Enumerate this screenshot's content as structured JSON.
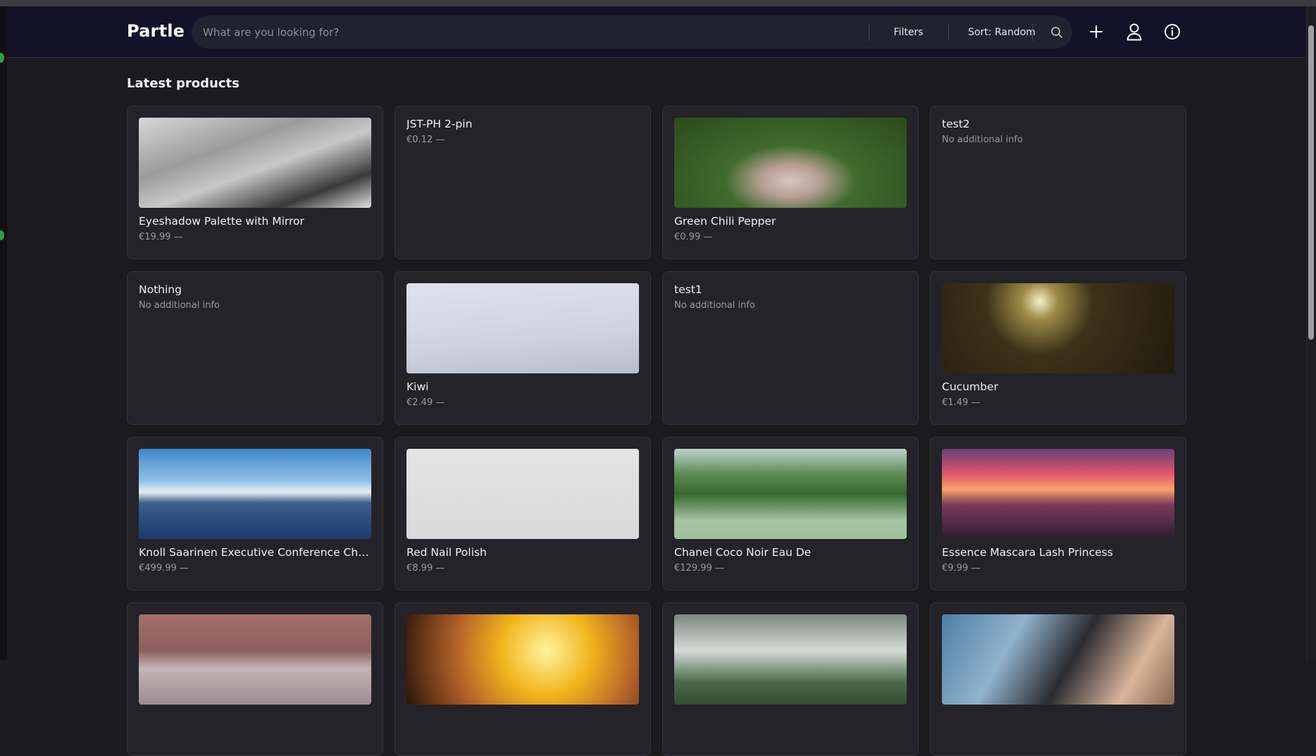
{
  "app": {
    "brand": "Partle"
  },
  "search": {
    "placeholder": "What are you looking for?",
    "value": "",
    "filters_label": "Filters",
    "sort_label": "Sort: Random"
  },
  "icons": {
    "search": "search-icon",
    "add": "plus-icon",
    "account": "user-icon",
    "info": "info-icon"
  },
  "section": {
    "title": "Latest products"
  },
  "products": [
    {
      "name": "Eyeshadow Palette with Mirror",
      "sub": "€19.99 —",
      "has_image": true,
      "image": "bw-laptop-keyboard"
    },
    {
      "name": "JST-PH 2-pin",
      "sub": "€0.12 —",
      "has_image": false
    },
    {
      "name": "Green Chili Pepper",
      "sub": "€0.99 —",
      "has_image": true,
      "image": "blanket-in-forest"
    },
    {
      "name": "test2",
      "sub": "No additional info",
      "has_image": false
    },
    {
      "name": "Nothing",
      "sub": "No additional info",
      "has_image": false
    },
    {
      "name": "Kiwi",
      "sub": "€2.49 —",
      "has_image": true,
      "image": "pale-sky"
    },
    {
      "name": "test1",
      "sub": "No additional info",
      "has_image": false
    },
    {
      "name": "Cucumber",
      "sub": "€1.49 —",
      "has_image": true,
      "image": "sunlit-forest"
    },
    {
      "name": "Knoll Saarinen Executive Conference Chair",
      "sub": "€499.99 —",
      "has_image": true,
      "image": "ocean-clouds"
    },
    {
      "name": "Red Nail Polish",
      "sub": "€8.99 —",
      "has_image": true,
      "image": "light-gray"
    },
    {
      "name": "Chanel Coco Noir Eau De",
      "sub": "€129.99 —",
      "has_image": true,
      "image": "misty-hills"
    },
    {
      "name": "Essence Mascara Lash Princess",
      "sub": "€9.99 —",
      "has_image": true,
      "image": "sunset-sea"
    },
    {
      "name": "",
      "sub": "",
      "has_image": true,
      "image": "lake-hills"
    },
    {
      "name": "",
      "sub": "",
      "has_image": true,
      "image": "food-closeup"
    },
    {
      "name": "",
      "sub": "",
      "has_image": true,
      "image": "foggy-trees"
    },
    {
      "name": "",
      "sub": "",
      "has_image": true,
      "image": "camera-hands"
    }
  ],
  "colors": {
    "header_bg": "#131228",
    "page_bg": "#1b1b1d",
    "card_bg": "#242329",
    "search_bg": "#22222e"
  }
}
